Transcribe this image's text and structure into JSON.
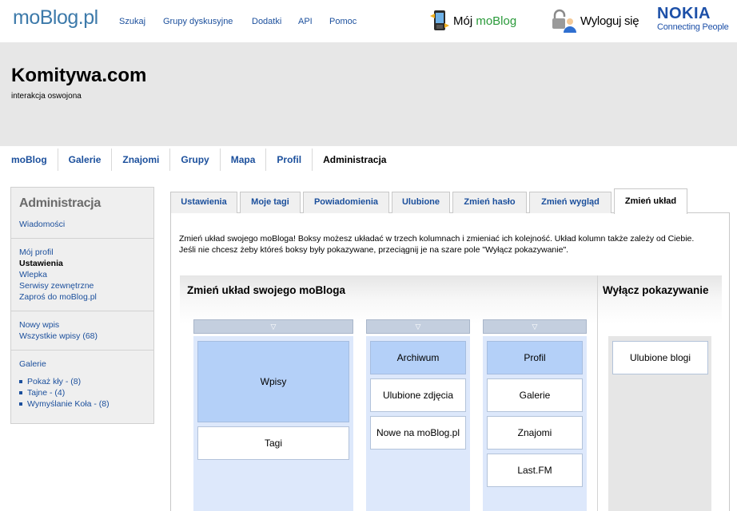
{
  "topbar": {
    "logo_main": "moBlog",
    "logo_suffix": ".pl",
    "links": [
      "Szukaj",
      "Grupy dyskusyjne",
      "Dodatki",
      "API",
      "Pomoc"
    ],
    "my_moblog_prefix": "Mój",
    "my_moblog_brand": "moBlog",
    "logout": "Wyloguj się",
    "nokia": "NOKIA",
    "nokia_tagline": "Connecting People"
  },
  "header": {
    "title": "Komitywa.com",
    "subtitle": "interakcja oswojona"
  },
  "mainnav": [
    "moBlog",
    "Galerie",
    "Znajomi",
    "Grupy",
    "Mapa",
    "Profil",
    "Administracja"
  ],
  "sidebar": {
    "title": "Administracja",
    "group1": [
      "Wiadomości"
    ],
    "group2": [
      "Mój profil",
      "Ustawienia",
      "Wlepka",
      "Serwisy zewnętrzne",
      "Zaproś do moBlog.pl"
    ],
    "group3": [
      "Nowy wpis",
      "Wszystkie wpisy (68)"
    ],
    "galleries_label": "Galerie",
    "galleries": [
      "Pokaż kły - (8)",
      "Tajne - (4)",
      "Wymyślanie Koła - (8)"
    ]
  },
  "tabs": [
    "Ustawienia",
    "Moje tagi",
    "Powiadomienia",
    "Ulubione",
    "Zmień hasło",
    "Zmień wygląd",
    "Zmień układ"
  ],
  "intro": {
    "line1": "Zmień układ swojego moBloga! Boksy możesz układać w trzech kolumnach i zmieniać ich kolejność. Układ kolumn także zależy od Ciebie.",
    "line2": "Jeśli nie chcesz żeby któreś boksy były pokazywane, przeciągnij je na szare pole \"Wyłącz pokazywanie\"."
  },
  "layout": {
    "title": "Zmień układ swojego moBloga",
    "column_toggle_icon": "▽",
    "col1": [
      "Wpisy",
      "Tagi"
    ],
    "col2": [
      "Archiwum",
      "Ulubione zdjęcia",
      "Nowe na moBlog.pl"
    ],
    "col3": [
      "Profil",
      "Galerie",
      "Znajomi",
      "Last.FM"
    ]
  },
  "hidden": {
    "title": "Wyłącz pokazywanie",
    "boxes": [
      "Ulubione blogi"
    ]
  }
}
